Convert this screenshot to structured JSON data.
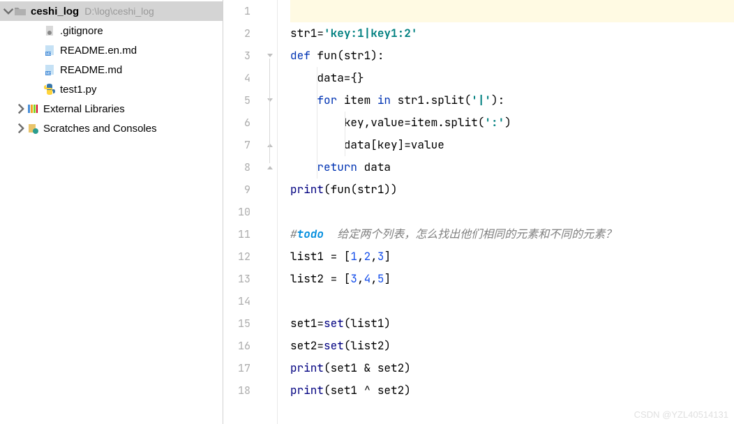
{
  "sidebar": {
    "root": {
      "name": "ceshi_log",
      "path": "D:\\log\\ceshi_log"
    },
    "files": [
      {
        "name": ".gitignore",
        "type": "gitignore"
      },
      {
        "name": "README.en.md",
        "type": "md"
      },
      {
        "name": "README.md",
        "type": "md"
      },
      {
        "name": "test1.py",
        "type": "py"
      }
    ],
    "external": "External Libraries",
    "scratches": "Scratches and Consoles"
  },
  "editor": {
    "lines": [
      {
        "n": 1,
        "segs": []
      },
      {
        "n": 2,
        "segs": [
          [
            "plain",
            "str1="
          ],
          [
            "str",
            "'key:1|key1:2'"
          ]
        ]
      },
      {
        "n": 3,
        "segs": [
          [
            "kw",
            "def"
          ],
          [
            "plain",
            " "
          ],
          [
            "fn",
            "fun"
          ],
          [
            "plain",
            "(str1):"
          ]
        ]
      },
      {
        "n": 4,
        "segs": [
          [
            "plain",
            "    data={}"
          ]
        ]
      },
      {
        "n": 5,
        "segs": [
          [
            "plain",
            "    "
          ],
          [
            "kw",
            "for"
          ],
          [
            "plain",
            " item "
          ],
          [
            "kw",
            "in"
          ],
          [
            "plain",
            " str1.split("
          ],
          [
            "str",
            "'|'"
          ],
          [
            "plain",
            "):"
          ]
        ]
      },
      {
        "n": 6,
        "segs": [
          [
            "plain",
            "        key,value=item.split("
          ],
          [
            "str",
            "':'"
          ],
          [
            "plain",
            ")"
          ]
        ]
      },
      {
        "n": 7,
        "segs": [
          [
            "plain",
            "        data[key]=value"
          ]
        ]
      },
      {
        "n": 8,
        "segs": [
          [
            "plain",
            "    "
          ],
          [
            "kw",
            "return"
          ],
          [
            "plain",
            " data"
          ]
        ]
      },
      {
        "n": 9,
        "segs": [
          [
            "builtin",
            "print"
          ],
          [
            "plain",
            "(fun(str1))"
          ]
        ]
      },
      {
        "n": 10,
        "segs": []
      },
      {
        "n": 11,
        "segs": [
          [
            "comment",
            "#"
          ],
          [
            "todo",
            "todo"
          ],
          [
            "todo-text",
            "  给定两个列表，怎么找出他们相同的元素和不同的元素？"
          ]
        ]
      },
      {
        "n": 12,
        "segs": [
          [
            "plain",
            "list1 = ["
          ],
          [
            "num",
            "1"
          ],
          [
            "plain",
            ","
          ],
          [
            "num",
            "2"
          ],
          [
            "plain",
            ","
          ],
          [
            "num",
            "3"
          ],
          [
            "plain",
            "]"
          ]
        ]
      },
      {
        "n": 13,
        "segs": [
          [
            "plain",
            "list2 = ["
          ],
          [
            "num",
            "3"
          ],
          [
            "plain",
            ","
          ],
          [
            "num",
            "4"
          ],
          [
            "plain",
            ","
          ],
          [
            "num",
            "5"
          ],
          [
            "plain",
            "]"
          ]
        ]
      },
      {
        "n": 14,
        "segs": []
      },
      {
        "n": 15,
        "segs": [
          [
            "plain",
            "set1="
          ],
          [
            "builtin",
            "set"
          ],
          [
            "plain",
            "(list1)"
          ]
        ]
      },
      {
        "n": 16,
        "segs": [
          [
            "plain",
            "set2="
          ],
          [
            "builtin",
            "set"
          ],
          [
            "plain",
            "(list2)"
          ]
        ]
      },
      {
        "n": 17,
        "segs": [
          [
            "builtin",
            "print"
          ],
          [
            "plain",
            "(set1 & set2)"
          ]
        ]
      },
      {
        "n": 18,
        "segs": [
          [
            "builtin",
            "print"
          ],
          [
            "plain",
            "(set1 ^ set2)"
          ]
        ]
      }
    ]
  },
  "watermark": "CSDN @YZL40514131"
}
